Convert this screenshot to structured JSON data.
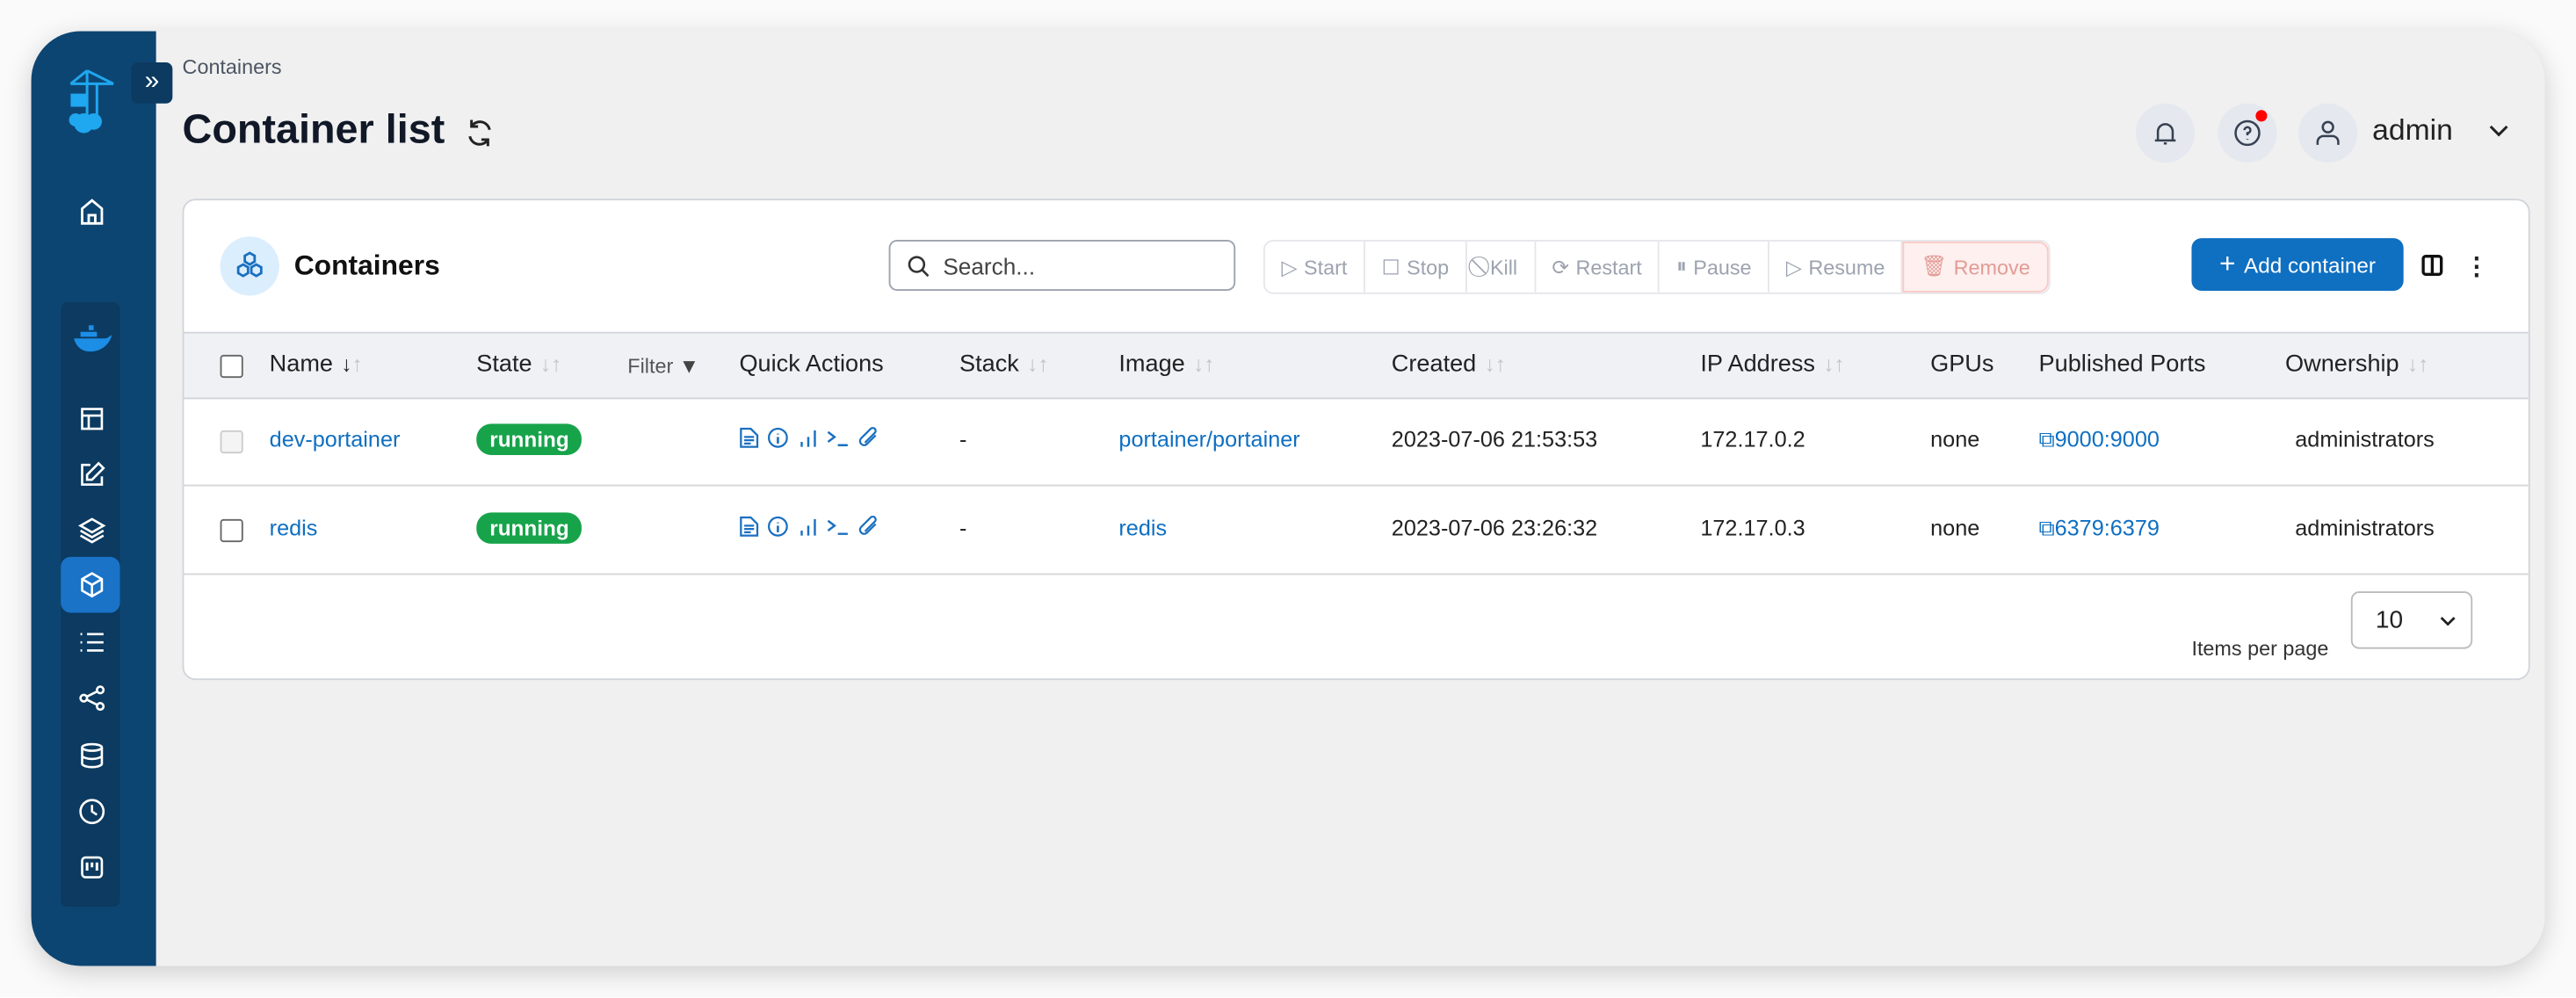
{
  "breadcrumb": "Containers",
  "page_title": "Container list",
  "user": {
    "name": "admin"
  },
  "card": {
    "title": "Containers"
  },
  "search": {
    "placeholder": "Search..."
  },
  "actions": {
    "start": "Start",
    "stop": "Stop",
    "kill": "Kill",
    "restart": "Restart",
    "pause": "Pause",
    "resume": "Resume",
    "remove": "Remove",
    "add": "Add container"
  },
  "columns": {
    "name": "Name",
    "state": "State",
    "filter": "Filter",
    "quick_actions": "Quick Actions",
    "stack": "Stack",
    "image": "Image",
    "created": "Created",
    "ip": "IP Address",
    "gpus": "GPUs",
    "ports": "Published Ports",
    "ownership": "Ownership"
  },
  "rows": [
    {
      "name": "dev-portainer",
      "state": "running",
      "stack": "-",
      "image": "portainer/portainer",
      "created": "2023-07-06 21:53:53",
      "ip": "172.17.0.2",
      "gpus": "none",
      "ports": "9000:9000",
      "ownership": "administrators"
    },
    {
      "name": "redis",
      "state": "running",
      "stack": "-",
      "image": "redis",
      "created": "2023-07-06 23:26:32",
      "ip": "172.17.0.3",
      "gpus": "none",
      "ports": "6379:6379",
      "ownership": "administrators"
    }
  ],
  "pagination": {
    "label": "Items per page",
    "value": "10"
  },
  "colors": {
    "sidebar": "#0d4572",
    "primary": "#0f6fc1",
    "running": "#17a34a",
    "remove": "#e39b95"
  }
}
